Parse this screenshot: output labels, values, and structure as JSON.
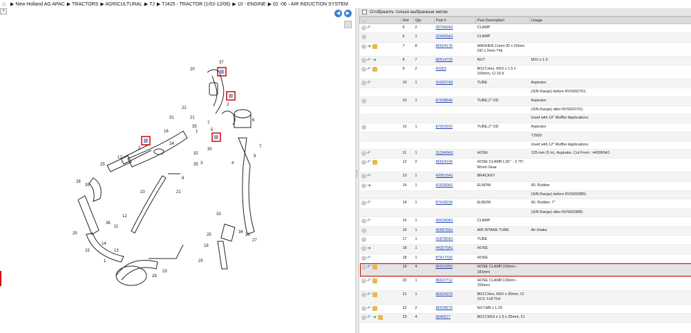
{
  "breadcrumb": {
    "items": [
      "New Holland AG APAC",
      "TRACTORS",
      "AGRICULTURAL",
      "TJ",
      "TJ425 - TRACTOR (1/02-12/06)",
      "10 - ENGINE",
      "02 -06 - AIR INDUCTION SYSTEM"
    ]
  },
  "filter": {
    "label": "Отобразить только выбранные метки"
  },
  "columns": [
    "Ref",
    "Qty",
    "Part #",
    "Part Description",
    "Usage"
  ],
  "rows": [
    {
      "ref": "6",
      "qty": "2",
      "part": "357942A2",
      "desc": "CLAMP",
      "usage": "",
      "icons": [
        "info",
        "back"
      ]
    },
    {
      "ref": "6",
      "qty": "1",
      "part": "324466A1",
      "desc": "CLAMP",
      "usage": "",
      "icons": [
        "info"
      ]
    },
    {
      "ref": "7",
      "qty": "8",
      "part": "86624176",
      "desc": "WASHER,11mm ID x 20mm OD x 2mm Thk",
      "usage": "",
      "icons": [
        "info",
        "fwd",
        "pkg"
      ]
    },
    {
      "ref": "8",
      "qty": "7",
      "part": "86514726",
      "desc": "NUT",
      "usage": "M10 x 1.5",
      "icons": [
        "info",
        "back",
        "fwd"
      ]
    },
    {
      "ref": "9",
      "qty": "2",
      "part": "43253",
      "desc": "BOLT,Hex, M10 x 1.5 x 100mm, Cl 10.9",
      "usage": "",
      "icons": [
        "info",
        "back",
        "pkg"
      ]
    },
    {
      "ref": "10",
      "qty": "1",
      "part": "419267A2",
      "desc": "TUBE",
      "usage": "Aspirator",
      "icons": [
        "info",
        "back"
      ]
    },
    {
      "ref": "",
      "qty": "",
      "part": "",
      "desc": "",
      "usage": "(S/N Range) before RVS002701;",
      "icons": []
    },
    {
      "ref": "10",
      "qty": "1",
      "part": "87438646",
      "desc": "TUBE,2\" OD",
      "usage": "Aspirator",
      "icons": [
        "info"
      ]
    },
    {
      "ref": "",
      "qty": "",
      "part": "",
      "desc": "",
      "usage": "(S/N Range) after RVS002701;",
      "icons": []
    },
    {
      "ref": "",
      "qty": "",
      "part": "",
      "desc": "",
      "usage": "Used with 10\" Muffler Applications",
      "icons": []
    },
    {
      "ref": "10",
      "qty": "1",
      "part": "87653015",
      "desc": "TUBE,2\" OD",
      "usage": "Aspirator",
      "icons": [
        "info"
      ]
    },
    {
      "ref": "",
      "qty": "",
      "part": "",
      "desc": "",
      "usage": "TJ500",
      "icons": []
    },
    {
      "ref": "",
      "qty": "",
      "part": "",
      "desc": "",
      "usage": "Used with 12\" Muffler Applications",
      "icons": []
    },
    {
      "ref": "11",
      "qty": "1",
      "part": "313949A3",
      "desc": "HOSE",
      "usage": "135 mm (5 in), Aspirator, Cut From : 443069A1",
      "icons": [
        "info",
        "back"
      ]
    },
    {
      "ref": "12",
      "qty": "2",
      "part": "86624194",
      "desc": "HOSE CLAMP,1.81\" - 2.75\", Worm Gear",
      "usage": "",
      "icons": [
        "info",
        "back",
        "pkg"
      ]
    },
    {
      "ref": "13",
      "qty": "1",
      "part": "430515A1",
      "desc": "BRACKET",
      "usage": "",
      "icons": [
        "info",
        "back"
      ]
    },
    {
      "ref": "14",
      "qty": "1",
      "part": "419280A1",
      "desc": "ELBOW",
      "usage": "90, Rubber",
      "icons": [
        "info",
        "fwd"
      ]
    },
    {
      "ref": "",
      "qty": "",
      "part": "",
      "desc": "",
      "usage": "(S/N Range) before RVS002885;",
      "icons": []
    },
    {
      "ref": "14",
      "qty": "1",
      "part": "87418234",
      "desc": "ELBOW",
      "usage": "90, Rubber, 7\"",
      "icons": [
        "info",
        "back"
      ]
    },
    {
      "ref": "",
      "qty": "",
      "part": "",
      "desc": "",
      "usage": "(S/N Range) after RVS002885;",
      "icons": []
    },
    {
      "ref": "15",
      "qty": "1",
      "part": "434180A1",
      "desc": "CLAMP",
      "usage": "",
      "icons": [
        "info",
        "back"
      ]
    },
    {
      "ref": "16",
      "qty": "1",
      "part": "406876A1",
      "desc": "AIR INTAKE TUBE",
      "usage": "Air Intake",
      "icons": [
        "info"
      ]
    },
    {
      "ref": "17",
      "qty": "1",
      "part": "418782A1",
      "desc": "TUBE",
      "usage": "",
      "icons": [
        "info"
      ]
    },
    {
      "ref": "18",
      "qty": "1",
      "part": "443075A1",
      "desc": "HOSE",
      "usage": "",
      "icons": [
        "info",
        "fwd"
      ]
    },
    {
      "ref": "18",
      "qty": "1",
      "part": "87417332",
      "desc": "HOSE",
      "usage": "",
      "icons": [
        "info",
        "back"
      ]
    },
    {
      "ref": "19",
      "qty": "4",
      "part": "86633350",
      "desc": "HOSE CLAMP,159mm - 181mm",
      "usage": "",
      "icons": [
        "info",
        "back",
        "pkg"
      ],
      "selected": true
    },
    {
      "ref": "20",
      "qty": "1",
      "part": "86637712",
      "desc": "HOSE CLAMP,133mm - 156mm",
      "usage": "",
      "icons": [
        "info",
        "back",
        "pkg"
      ]
    },
    {
      "ref": "21",
      "qty": "1",
      "part": "86624970",
      "desc": "BOLT,Hex, M10 x 35mm, Cl 10.9, Full Thd",
      "usage": "",
      "icons": [
        "info",
        "back",
        "pkg"
      ]
    },
    {
      "ref": "22",
      "qty": "2",
      "part": "86528579",
      "desc": "NUT,M8 x 1.25",
      "usage": "",
      "icons": [
        "info",
        "back",
        "pkg"
      ]
    },
    {
      "ref": "23",
      "qty": "4",
      "part": "9646577",
      "desc": "BOLT,M10 x 1.5 x 25mm, Cl",
      "usage": "",
      "icons": [
        "info",
        "back",
        "fwd",
        "pkg"
      ]
    }
  ],
  "diagram": {
    "callouts": [
      "37",
      "19",
      "20",
      "22",
      "18",
      "2",
      "31",
      "21",
      "35",
      "36",
      "16",
      "1",
      "7",
      "19",
      "5",
      "19",
      "2",
      "24",
      "4",
      "30",
      "32",
      "3",
      "8",
      "35",
      "6",
      "9",
      "17",
      "25",
      "28",
      "25",
      "10",
      "21",
      "12",
      "11",
      "36",
      "25",
      "14",
      "15",
      "1",
      "13",
      "23",
      "29",
      "26",
      "34",
      "27",
      "33",
      "18",
      "25",
      "7"
    ]
  },
  "colors": {
    "accent": "#1a3fb0",
    "highlight": "#d40000",
    "header": "#dcdcdc"
  }
}
